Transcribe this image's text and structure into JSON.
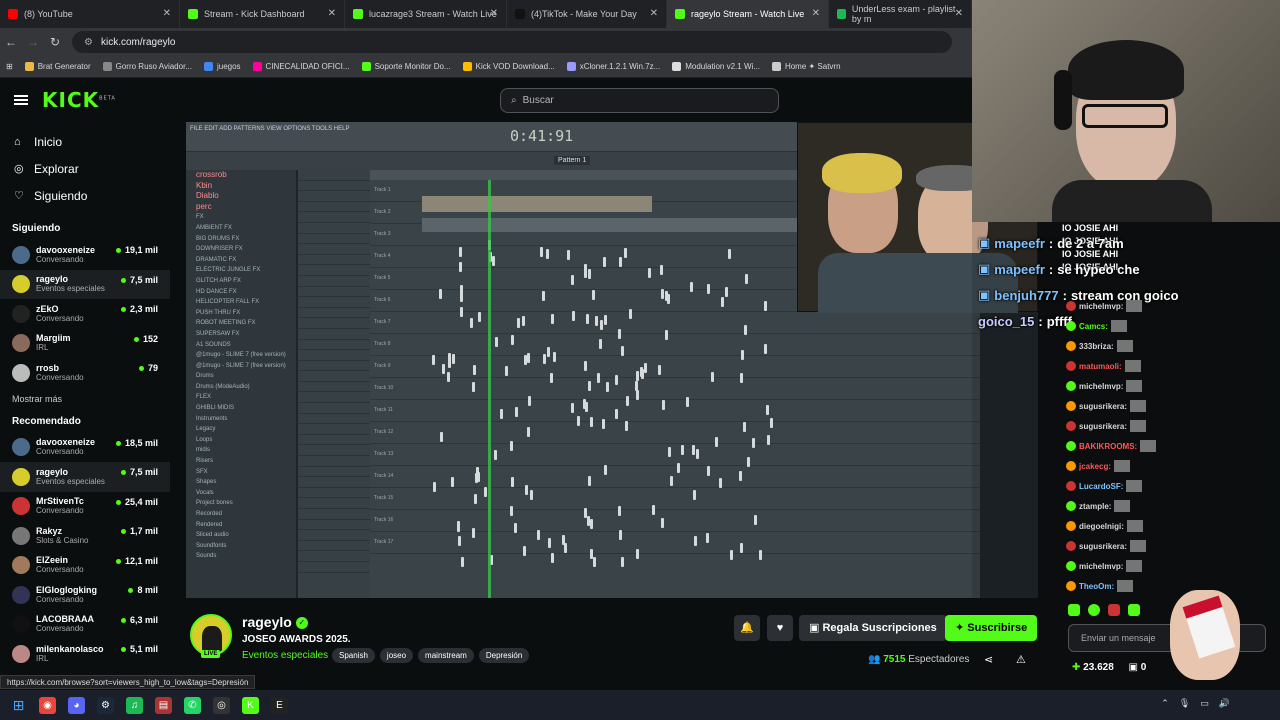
{
  "browser": {
    "tabs": [
      {
        "title": "(8) YouTube",
        "color": "#ff0000"
      },
      {
        "title": "Stream - Kick Dashboard",
        "color": "#53fc18"
      },
      {
        "title": "lucazrage3 Stream - Watch Live",
        "color": "#53fc18"
      },
      {
        "title": "(4)TikTok - Make Your Day",
        "color": "#111111"
      },
      {
        "title": "rageylo Stream - Watch Live",
        "color": "#53fc18",
        "active": true
      },
      {
        "title": "UnderLess exam - playlist by m",
        "color": "#1db954"
      }
    ],
    "url": "kick.com/rageylo",
    "bookmarks": [
      "Brat Generator",
      "Gorro Ruso Aviador...",
      "juegos",
      "CINECALIDAD OFICI...",
      "Soporte Monitor Do...",
      "Kick VOD Download...",
      "xCloner.1.2.1 Win.7z...",
      "Modulation v2.1 Wi...",
      "Home ✦ Satvrn"
    ],
    "status_url": "https://kick.com/browse?sort=viewers_high_to_low&tags=Depresión"
  },
  "kick": {
    "logo": "KICK",
    "logo_badge": "BETA",
    "search_placeholder": "Buscar",
    "nav": [
      {
        "label": "Inicio",
        "icon": "home-icon"
      },
      {
        "label": "Explorar",
        "icon": "compass-icon"
      },
      {
        "label": "Siguiendo",
        "icon": "heart-icon"
      }
    ],
    "following_title": "Siguiendo",
    "following": [
      {
        "name": "davooxeneize",
        "category": "Conversando",
        "viewers": "19,1 mil",
        "color": "#4a6b8a"
      },
      {
        "name": "rageylo",
        "category": "Eventos especiales",
        "viewers": "7,5 mil",
        "color": "#d6cd2c"
      },
      {
        "name": "zEkO",
        "category": "Conversando",
        "viewers": "2,3 mil",
        "color": "#222"
      },
      {
        "name": "Margiim",
        "category": "IRL",
        "viewers": "152",
        "color": "#8a6a5a"
      },
      {
        "name": "rrosb",
        "category": "Conversando",
        "viewers": "79",
        "color": "#bbbbbb"
      }
    ],
    "show_more": "Mostrar más",
    "recommended_title": "Recomendado",
    "recommended": [
      {
        "name": "davooxeneize",
        "category": "Conversando",
        "viewers": "18,5 mil",
        "color": "#4a6b8a"
      },
      {
        "name": "rageylo",
        "category": "Eventos especiales",
        "viewers": "7,5 mil",
        "color": "#d6cd2c"
      },
      {
        "name": "MrStivenTc",
        "category": "Conversando",
        "viewers": "25,4 mil",
        "color": "#c33"
      },
      {
        "name": "Rakyz",
        "category": "Slots & Casino",
        "viewers": "1,7 mil",
        "color": "#777"
      },
      {
        "name": "ElZeein",
        "category": "Conversando",
        "viewers": "12,1 mil",
        "color": "#a07a5a"
      },
      {
        "name": "ElGloglogking",
        "category": "Conversando",
        "viewers": "8 mil",
        "color": "#335"
      },
      {
        "name": "LACOBRAAA",
        "category": "Conversando",
        "viewers": "6,3 mil",
        "color": "#111"
      },
      {
        "name": "milenkanolasco",
        "category": "IRL",
        "viewers": "5,1 mil",
        "color": "#b88"
      }
    ]
  },
  "daw": {
    "time": "0:41:91",
    "menu": "FILE EDIT ADD PATTERNS VIEW OPTIONS TOOLS HELP",
    "browser_items": [
      "crossrob",
      "Kbin",
      "Diablo",
      "perc",
      "FX",
      "AMBIENT FX",
      "BIG DRUMS FX",
      "DOWNRISER FX",
      "DRAMATIC FX",
      "ELECTRIC JUNGLE FX",
      "GLITCH ARP FX",
      "HD DANCE FX",
      "HELICOPTER FALL FX",
      "PUSH THRU FX",
      "ROBOT MEETING FX",
      "SUPERSAW FX",
      "A1 SOUNDS",
      "@1mugo - SLIME 7 (free version)",
      "@1mugo - SLIME 7 (free version)",
      "Drums",
      "Drums (ModeAudio)",
      "FLEX",
      "GHIBLI MIDIS",
      "Instruments",
      "Legacy",
      "Loops",
      "midis",
      "Risers",
      "SFX",
      "Shapes",
      "Vocals",
      "Project bones",
      "Recorded",
      "Rendered",
      "Sliced audio",
      "Soundfonts",
      "Sounds"
    ],
    "tracks": [
      "Track 1",
      "Track 2",
      "Track 3",
      "Track 4",
      "Track 5",
      "Track 6",
      "Track 7",
      "Track 8",
      "Track 9",
      "Track 10",
      "Track 11",
      "Track 12",
      "Track 13",
      "Track 14",
      "Track 15",
      "Track 16",
      "Track 17"
    ],
    "pattern": "Pattern 1"
  },
  "overlay_chat": [
    {
      "user": "mapeefr",
      "msg": "de 2 a 7am"
    },
    {
      "user": "mapeefr",
      "msg": "se hypeo che"
    },
    {
      "user": "benjuh777",
      "msg": "stream con goico"
    },
    {
      "user": "goico_15",
      "msg": "pffff"
    }
  ],
  "overlay_spam": "IO JOSIE AHI",
  "kick_chat": [
    {
      "user": "michelmvp:",
      "color": "#d6d6d6"
    },
    {
      "user": "Camcs:",
      "color": "#53fc18"
    },
    {
      "user": "333briza:",
      "color": "#d6d6d6"
    },
    {
      "user": "matumaoli:",
      "color": "#ff5555"
    },
    {
      "user": "michelmvp:",
      "color": "#d6d6d6"
    },
    {
      "user": "sugusrikera:",
      "color": "#d6d6d6"
    },
    {
      "user": "sugusrikera:",
      "color": "#d6d6d6"
    },
    {
      "user": "BAKIKROOMS:",
      "color": "#ff5555"
    },
    {
      "user": "jcakecg:",
      "color": "#ff5555"
    },
    {
      "user": "LucardoSF:",
      "color": "#7ec3ff"
    },
    {
      "user": "ztample:",
      "color": "#d6d6d6"
    },
    {
      "user": "diegoelnigi:",
      "color": "#d6d6d6"
    },
    {
      "user": "sugusrikera:",
      "color": "#d6d6d6"
    },
    {
      "user": "michelmvp:",
      "color": "#d6d6d6"
    },
    {
      "user": "TheoOm:",
      "color": "#7ec3ff"
    }
  ],
  "chat_input_placeholder": "Enviar un mensaje",
  "chat_points": "23.628",
  "chat_gifts": "0",
  "stream": {
    "name": "rageylo",
    "title": "JOSEO AWARDS 2025.",
    "category": "Eventos especiales",
    "live_label": "LIVE",
    "tags": [
      "Spanish",
      "joseo",
      "mainstream",
      "Depresión"
    ],
    "gift_label": "Regala Suscripciones",
    "subscribe_label": "Suscribirse",
    "viewers_count": "7515",
    "viewers_label": "Espectadores"
  },
  "accent": "#53fc18"
}
